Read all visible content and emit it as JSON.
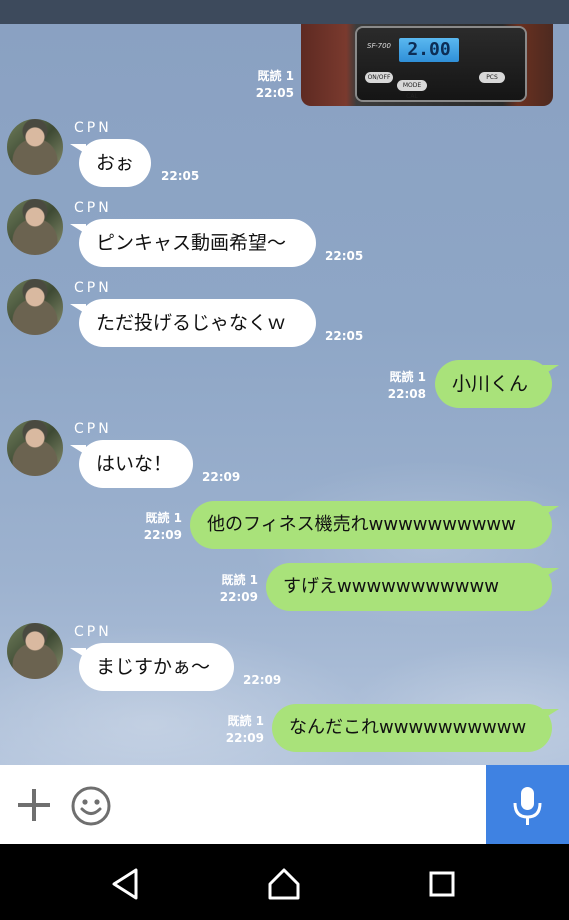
{
  "photo": {
    "scale_model": "SF-700",
    "lcd_value": "2.00",
    "btn_onoff": "ON/OFF",
    "btn_mode": "MODE CAL",
    "btn_pcs": "PCS"
  },
  "messages": [
    {
      "side": "out",
      "read": "既読 1",
      "time": "22:05",
      "type": "photo"
    },
    {
      "side": "in",
      "sender": "CPN",
      "text": "おぉ",
      "time": "22:05"
    },
    {
      "side": "in",
      "sender": "CPN",
      "text": "ピンキャス動画希望〜",
      "time": "22:05"
    },
    {
      "side": "in",
      "sender": "CPN",
      "text": "ただ投げるじゃなくｗ",
      "time": "22:05"
    },
    {
      "side": "out",
      "read": "既読 1",
      "text": "小川くん",
      "time": "22:08"
    },
    {
      "side": "in",
      "sender": "CPN",
      "text": "はいな！",
      "time": "22:09"
    },
    {
      "side": "out",
      "read": "既読 1",
      "text": "他のフィネス機売れwwwwwwwwww",
      "time": "22:09"
    },
    {
      "side": "out",
      "read": "既読 1",
      "text": "すげえwwwwwwwwwww",
      "time": "22:09"
    },
    {
      "side": "in",
      "sender": "CPN",
      "text": "まじすかぁ〜",
      "time": "22:09"
    },
    {
      "side": "out",
      "read": "既読 1",
      "text": "なんだこれwwwwwwwwww",
      "time": "22:09"
    }
  ],
  "input_bar": {
    "plus_icon": "plus-icon",
    "emoji_icon": "smiley-icon",
    "mic_icon": "microphone-icon",
    "mic_color": "#3f82e2"
  },
  "nav": {
    "back_icon": "back-triangle-icon",
    "home_icon": "home-icon",
    "recents_icon": "recents-square-icon"
  },
  "colors": {
    "outgoing_bubble": "#a9e27a",
    "incoming_bubble": "#ffffff",
    "chat_bg": "#8ea6c6"
  }
}
